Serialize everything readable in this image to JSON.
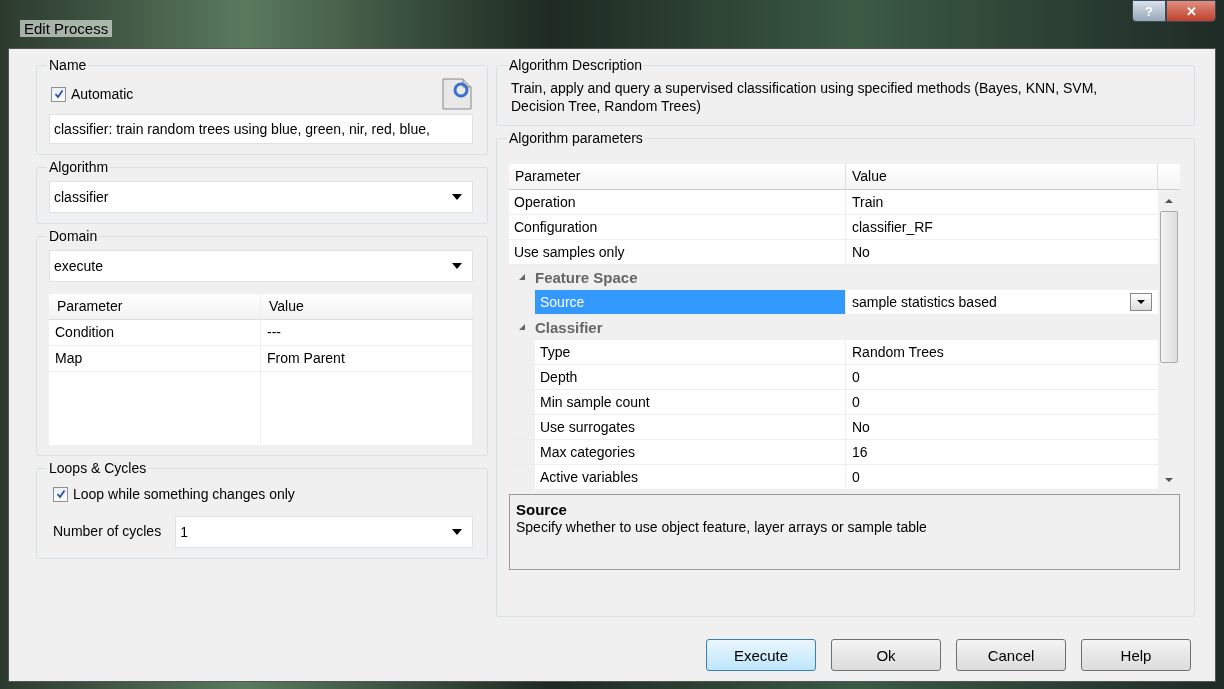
{
  "window": {
    "title": "Edit Process",
    "controls": [
      "?",
      "✕"
    ]
  },
  "name_group": {
    "label": "Name",
    "automatic": {
      "label": "Automatic",
      "checked": true
    },
    "value": "classifier: train random trees using blue, green, nir, red, blue,"
  },
  "algorithm": {
    "label": "Algorithm",
    "value": "classifier"
  },
  "domain": {
    "label": "Domain",
    "value": "execute",
    "columns": [
      "Parameter",
      "Value"
    ],
    "rows": [
      {
        "name": "Condition",
        "value": "---"
      },
      {
        "name": "Map",
        "value": "From Parent"
      }
    ]
  },
  "loops": {
    "label": "Loops & Cycles",
    "loop_option": {
      "label": "Loop while something changes only",
      "checked": true
    },
    "cycles_label": "Number of cycles",
    "cycles_value": "1"
  },
  "description": {
    "label": "Algorithm Description",
    "text": "Train, apply and query a supervised classification using specified methods (Bayes, KNN, SVM, Decision Tree, Random Trees)"
  },
  "parameters": {
    "label": "Algorithm parameters",
    "columns": [
      "Parameter",
      "Value"
    ],
    "rows": [
      {
        "kind": "param",
        "name": "Operation",
        "value": "Train",
        "selected": false
      },
      {
        "kind": "param",
        "name": "Configuration",
        "value": "classifier_RF",
        "selected": false
      },
      {
        "kind": "param",
        "name": "Use samples only",
        "value": "No",
        "selected": false
      },
      {
        "kind": "category",
        "name": "Feature Space",
        "expanded": true,
        "children": [
          {
            "kind": "param",
            "name": "Source",
            "value": "sample statistics based",
            "selected": true
          }
        ]
      },
      {
        "kind": "category",
        "name": "Classifier",
        "expanded": true,
        "children": [
          {
            "kind": "param",
            "name": "Type",
            "value": "Random Trees",
            "selected": false
          },
          {
            "kind": "param",
            "name": "Depth",
            "value": "0",
            "selected": false
          },
          {
            "kind": "param",
            "name": "Min sample count",
            "value": "0",
            "selected": false
          },
          {
            "kind": "param",
            "name": "Use surrogates",
            "value": "No",
            "selected": false
          },
          {
            "kind": "param",
            "name": "Max categories",
            "value": "16",
            "selected": false
          },
          {
            "kind": "param",
            "name": "Active variables",
            "value": "0",
            "selected": false
          }
        ]
      }
    ],
    "help": {
      "title": "Source",
      "text": "Specify whether to use object feature, layer arrays or sample table"
    }
  },
  "buttons": [
    {
      "label": "Execute",
      "default": true
    },
    {
      "label": "Ok",
      "default": false
    },
    {
      "label": "Cancel",
      "default": false
    },
    {
      "label": "Help",
      "default": false
    }
  ]
}
